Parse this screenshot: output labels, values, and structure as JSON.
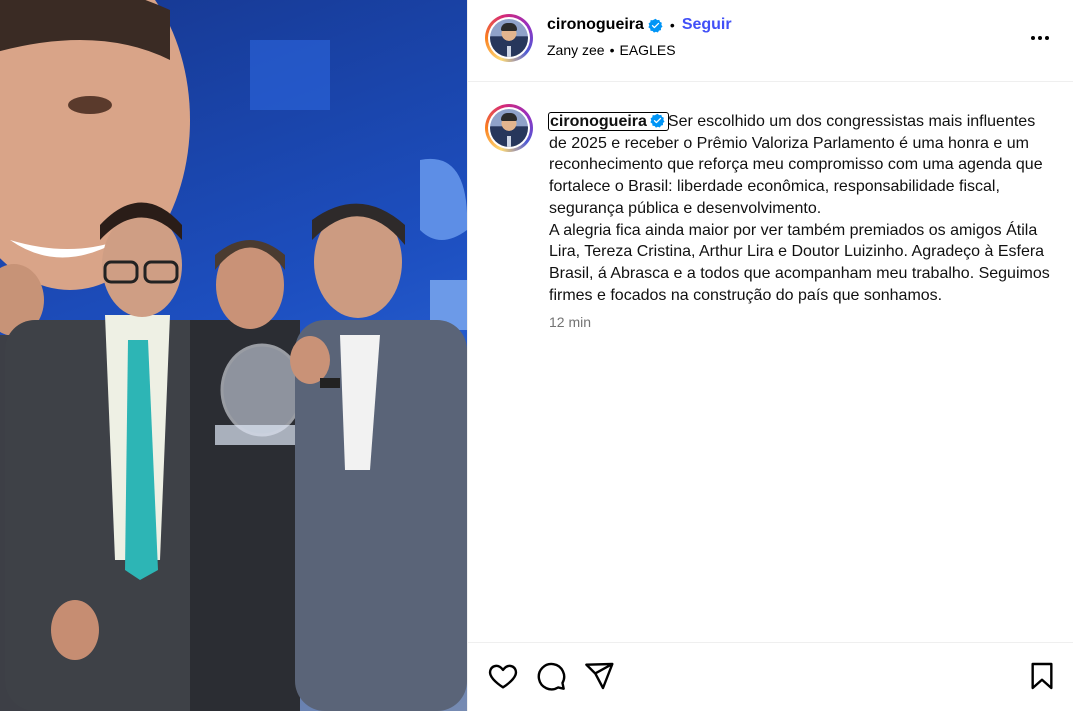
{
  "post": {
    "author": {
      "username": "cironogueira",
      "verified": true,
      "avatar": "profile-photo-man-in-suit"
    },
    "follow_label": "Seguir",
    "dot": "•",
    "music": {
      "artist": "Zany zee",
      "separator": "•",
      "track": "EAGLES"
    },
    "caption": {
      "username": "cironogueira",
      "text": "Ser escolhido um dos congressistas mais influentes de 2025 e receber o Prêmio Valoriza Parlamento é uma honra e um reconhecimento que reforça meu compromisso com uma agenda que fortalece o Brasil: liberdade econômica, responsabilidade fiscal, segurança pública e desenvolvimento.\nA alegria fica ainda maior por ver também premiados os amigos Átila Lira, Tereza Cristina, Arthur Lira e Doutor Luizinho. Agradeço à Esfera Brasil, á Abrasca e a todos que acompanham meu trabalho. Seguimos firmes e focados na construção do país que sonhamos.",
      "time": "12 min"
    },
    "icons": {
      "more": "more-options-icon",
      "like": "heart-icon",
      "comment": "comment-icon",
      "share": "share-icon",
      "save": "bookmark-icon",
      "verified": "verified-badge-icon"
    },
    "colors": {
      "follow": "#4150f7",
      "verified": "#0095f6",
      "timestamp": "#737373",
      "photo_background": "#1d4fc0"
    }
  }
}
